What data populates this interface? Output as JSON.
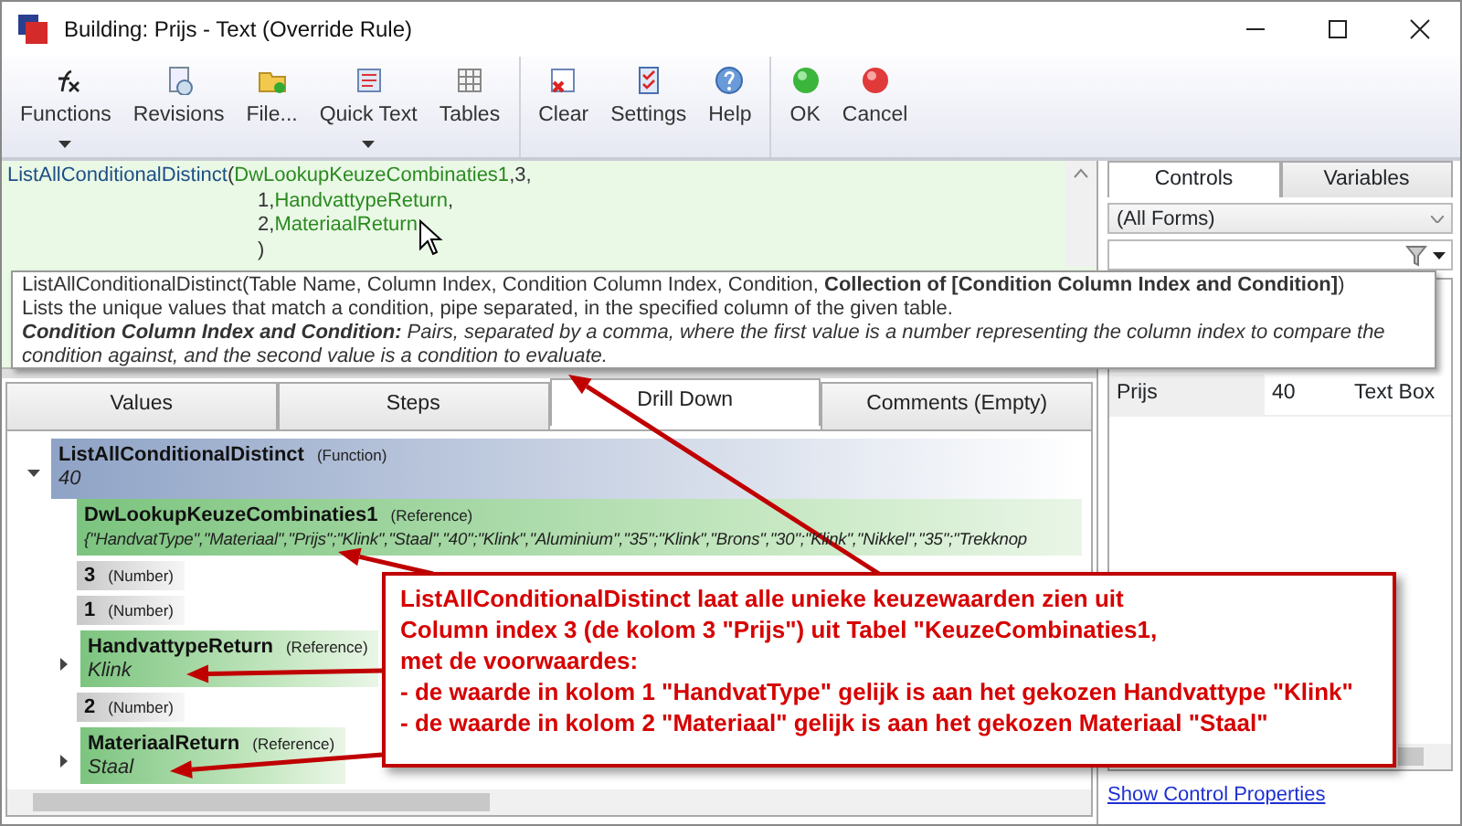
{
  "window": {
    "title": "Building: Prijs - Text (Override Rule)"
  },
  "toolbar": {
    "groups": [
      [
        {
          "label": "Functions",
          "dropdown": true
        },
        {
          "label": "Revisions",
          "dropdown": false
        },
        {
          "label": "File...",
          "dropdown": false
        },
        {
          "label": "Quick Text",
          "dropdown": true
        },
        {
          "label": "Tables",
          "dropdown": false
        }
      ],
      [
        {
          "label": "Clear",
          "dropdown": false
        },
        {
          "label": "Settings",
          "dropdown": false
        },
        {
          "label": "Help",
          "dropdown": false
        }
      ],
      [
        {
          "label": "OK",
          "dropdown": false
        },
        {
          "label": "Cancel",
          "dropdown": false
        }
      ]
    ]
  },
  "editor": {
    "lines": [
      [
        {
          "text": "ListAllConditionalDistinct",
          "kind": "function"
        },
        {
          "text": "(",
          "kind": "plain"
        },
        {
          "text": "DwLookupKeuzeCombinaties1",
          "kind": "reference"
        },
        {
          "text": ",3,",
          "kind": "plain"
        }
      ],
      [
        {
          "text": "1,",
          "kind": "plain"
        },
        {
          "text": "HandvattypeReturn",
          "kind": "reference"
        },
        {
          "text": ",",
          "kind": "plain"
        }
      ],
      [
        {
          "text": "2,",
          "kind": "plain"
        },
        {
          "text": "MateriaalReturn",
          "kind": "reference"
        }
      ],
      [
        {
          "text": ")",
          "kind": "plain"
        }
      ]
    ]
  },
  "tooltip": {
    "signature": "ListAllConditionalDistinct(Table Name, Column Index, Condition Column Index, Condition, **Collection of [Condition Column Index and Condition]**)",
    "description": "Lists the unique values that match a condition, pipe separated, in the specified column of the given table.",
    "parameter": "**Condition Column Index and Condition:** Pairs, separated by a comma, where the first value is a number representing the column index to compare the condition against, and the second value is a condition to evaluate."
  },
  "tabs": [
    {
      "label": "Values",
      "selected": false
    },
    {
      "label": "Steps",
      "selected": false
    },
    {
      "label": "Drill Down",
      "selected": true
    },
    {
      "label": "Comments (Empty)",
      "selected": false
    }
  ],
  "tree": [
    {
      "name": "ListAllConditionalDistinct",
      "type": "(Function)",
      "kind": "function",
      "value": "40",
      "expanded": true,
      "children": [
        {
          "name": "DwLookupKeuzeCombinaties1",
          "type": "(Reference)",
          "kind": "reference",
          "value": "{\"HandvatType\",\"Materiaal\",\"Prijs\";\"Klink\",\"Staal\",\"40\";\"Klink\",\"Aluminium\",\"35\";\"Klink\",\"Brons\",\"30\";\"Klink\",\"Nikkel\",\"35\";\"Trekknop"
        },
        {
          "name": "3",
          "type": "(Number)",
          "kind": "number"
        },
        {
          "name": "1",
          "type": "(Number)",
          "kind": "number"
        },
        {
          "name": "HandvattypeReturn",
          "type": "(Reference)",
          "kind": "reference",
          "value": "Klink",
          "expanded": false
        },
        {
          "name": "2",
          "type": "(Number)",
          "kind": "number"
        },
        {
          "name": "MateriaalReturn",
          "type": "(Reference)",
          "kind": "reference",
          "value": "Staal",
          "expanded": false
        }
      ]
    }
  ],
  "side_panel": {
    "tabs": [
      {
        "label": "Controls",
        "selected": true
      },
      {
        "label": "Variables",
        "selected": false
      }
    ],
    "form_select": "(All Forms)",
    "rows": [
      [
        "Prijs",
        "40",
        "Text Box"
      ]
    ],
    "link": "Show Control Properties"
  },
  "callout": [
    "ListAllConditionalDistinct laat alle unieke keuzewaarden zien uit",
    "Column index 3 (de kolom 3 \"Prijs\") uit Tabel \"KeuzeCombinaties1,",
    "met de voorwaardes:",
    "- de waarde in kolom 1 \"HandvatType\" gelijk is aan het gekozen Handvattype \"Klink\"",
    "- de waarde in kolom 2 \"Materiaal\" gelijk is aan het gekozen Materiaal \"Staal\""
  ]
}
